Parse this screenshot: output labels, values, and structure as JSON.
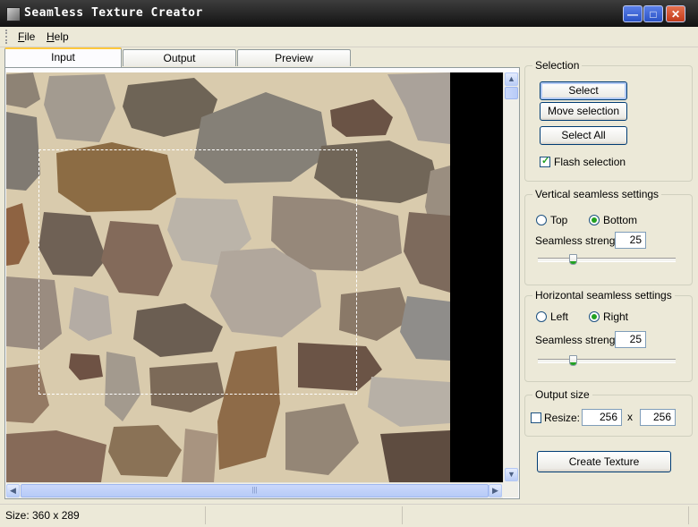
{
  "window": {
    "title": "Seamless Texture Creator"
  },
  "menu": {
    "file": "File",
    "help": "Help"
  },
  "tabs": [
    {
      "label": "Input",
      "active": true
    },
    {
      "label": "Output",
      "active": false
    },
    {
      "label": "Preview",
      "active": false
    }
  ],
  "selection": {
    "title": "Selection",
    "select_label": "Select",
    "move_label": "Move selection",
    "select_all_label": "Select All",
    "flash_label": "Flash selection",
    "flash_checked": true
  },
  "vertical": {
    "title": "Vertical seamless settings",
    "top_label": "Top",
    "bottom_label": "Bottom",
    "selected": "Bottom",
    "strength_label": "Seamless strength:",
    "strength_value": "25"
  },
  "horizontal": {
    "title": "Horizontal seamless settings",
    "left_label": "Left",
    "right_label": "Right",
    "selected": "Right",
    "strength_label": "Seamless strength:",
    "strength_value": "25"
  },
  "output_size": {
    "title": "Output size",
    "resize_label": "Resize:",
    "resize_checked": false,
    "width": "256",
    "separator": "x",
    "height": "256"
  },
  "create_button": "Create Texture",
  "status": {
    "size": "Size: 360 x 289"
  },
  "icons": {
    "minimize": "minimize-icon",
    "maximize": "maximize-icon",
    "close": "close-icon",
    "scroll_up": "arrow-up-icon",
    "scroll_down": "arrow-down-icon",
    "scroll_left": "arrow-left-icon",
    "scroll_right": "arrow-right-icon"
  },
  "colors": {
    "titlebar": "#121212",
    "accent_check": "#21a121",
    "tab_highlight": "#ffc83c",
    "scrollbar": "#b7cbf7"
  }
}
